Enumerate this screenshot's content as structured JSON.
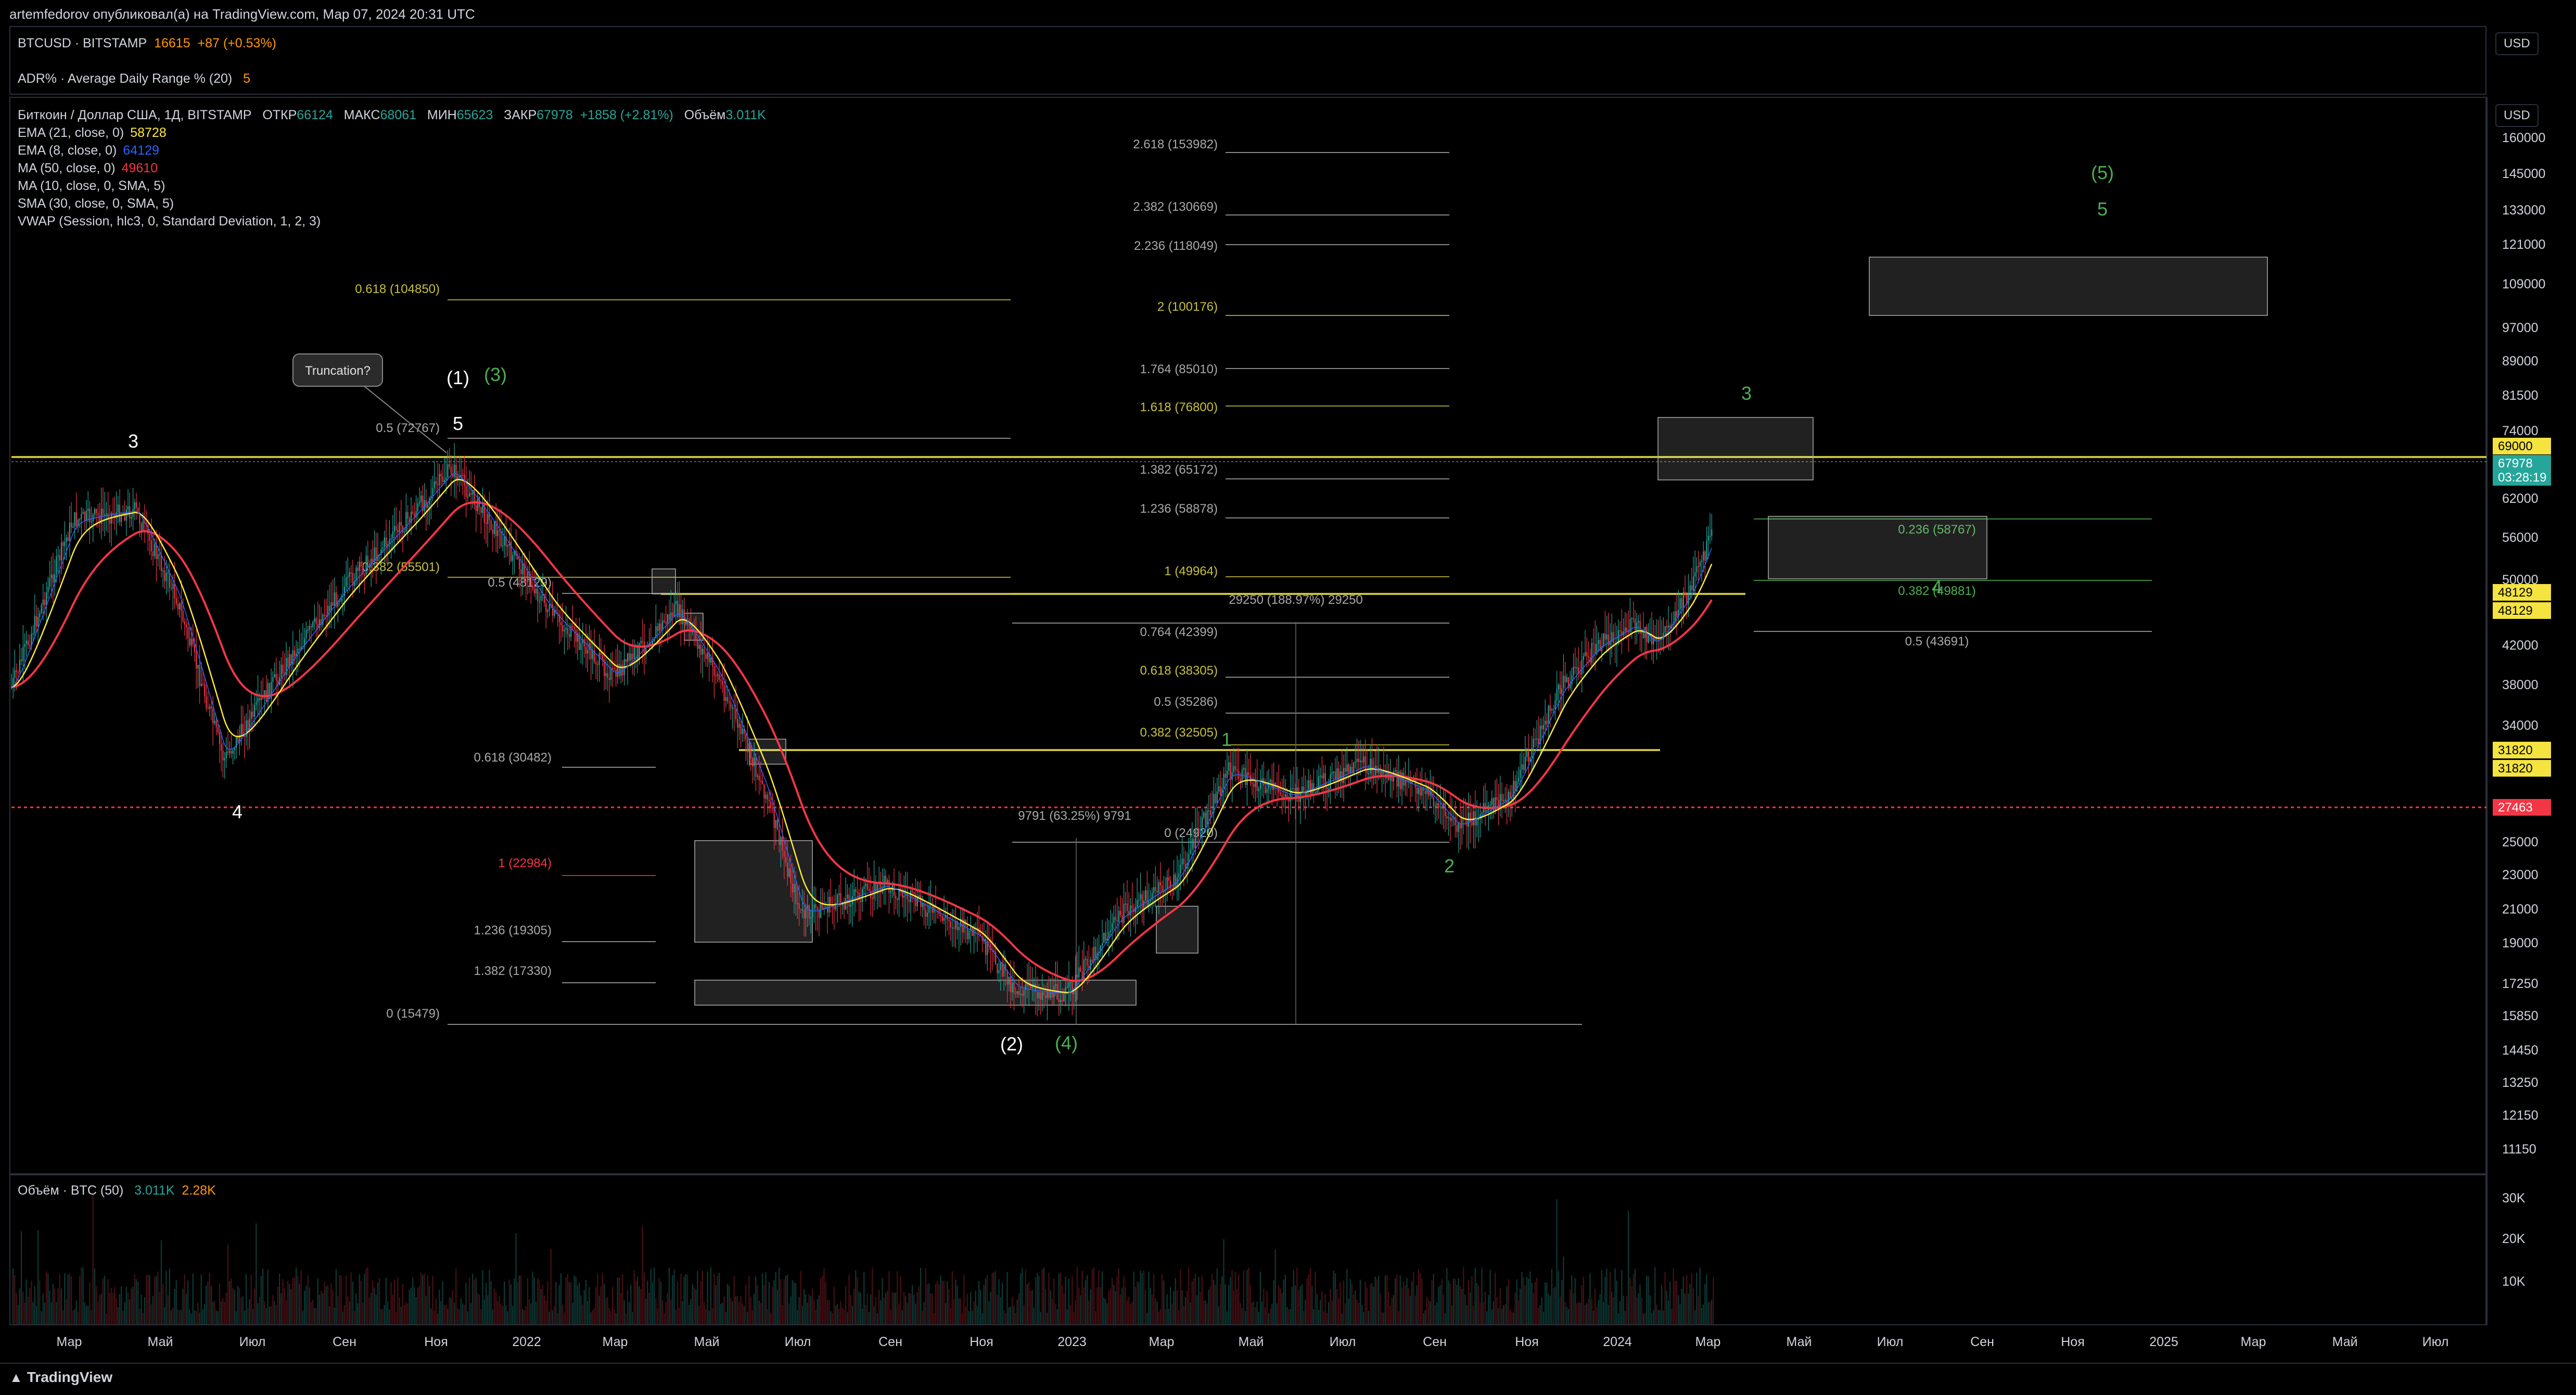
{
  "header": {
    "author_line": "artemfedorov опубликовал(а) на TradingView.com, Мар 07, 2024 20:31 UTC"
  },
  "top_panel": {
    "symbol": "BTCUSD · BITSTAMP",
    "value": "16615",
    "change": "+87 (+0.53%)",
    "indicator_name": "ADR% · Average Daily Range % (20)",
    "indicator_value": "5",
    "currency": "USD"
  },
  "main_legend": {
    "title": "Биткоин / Доллар США, 1Д, BITSTAMP",
    "open_label": "ОТКР",
    "open": "66124",
    "high_label": "МАКС",
    "high": "68061",
    "low_label": "МИН",
    "low": "65623",
    "close_label": "ЗАКР",
    "close": "67978",
    "change": "+1858 (+2.81%)",
    "volume_label": "Объём",
    "volume": "3.011K",
    "indicators": [
      {
        "name": "EMA (21, close, 0)",
        "value": "58728",
        "color": "#ffeb3b"
      },
      {
        "name": "EMA (8, close, 0)",
        "value": "64129",
        "color": "#2962ff"
      },
      {
        "name": "MA (50, close, 0)",
        "value": "49610",
        "color": "#f23645"
      },
      {
        "name": "MA (10, close, 0, SMA, 5)",
        "value": "",
        "color": "#d1d4dc"
      },
      {
        "name": "SMA (30, close, 0, SMA, 5)",
        "value": "",
        "color": "#d1d4dc"
      },
      {
        "name": "VWAP (Session, hlc3, 0, Standard Deviation, 1, 2, 3)",
        "value": "",
        "color": "#d1d4dc"
      }
    ],
    "currency": "USD"
  },
  "volume_panel": {
    "title": "Объём · BTC (50)",
    "value1": "3.011K",
    "value2": "2.28K",
    "value1_color": "#26a69a",
    "value2_color": "#ff9800",
    "scale": [
      "30K",
      "20K",
      "10K"
    ]
  },
  "price_axis": {
    "ticks": [
      "160000",
      "145000",
      "133000",
      "121000",
      "109000",
      "97000",
      "89000",
      "81500",
      "74000",
      "62000",
      "56000",
      "50000",
      "42000",
      "38000",
      "34000",
      "25000",
      "23000",
      "21000",
      "19000",
      "17250",
      "15850",
      "14450",
      "13250",
      "12150",
      "11150"
    ],
    "badges": [
      {
        "label": "69000",
        "bg": "#f5e33f",
        "fg": "#000000"
      },
      {
        "label": "67978",
        "bg": "#26a69a",
        "fg": "#ffffff"
      },
      {
        "label": "03:28:19",
        "bg": "#26a69a",
        "fg": "#ffffff"
      },
      {
        "label": "48129",
        "bg": "#f5e33f",
        "fg": "#000000"
      },
      {
        "label": "48129",
        "bg": "#f5e33f",
        "fg": "#000000"
      },
      {
        "label": "31820",
        "bg": "#f5e33f",
        "fg": "#000000"
      },
      {
        "label": "31820",
        "bg": "#f5e33f",
        "fg": "#000000"
      },
      {
        "label": "27463",
        "bg": "#f23645",
        "fg": "#ffffff"
      }
    ]
  },
  "time_axis": [
    "Мар",
    "Май",
    "Июл",
    "Сен",
    "Ноя",
    "2022",
    "Мар",
    "Май",
    "Июл",
    "Сен",
    "Ноя",
    "2023",
    "Мар",
    "Май",
    "Июл",
    "Сен",
    "Ноя",
    "2024",
    "Мар",
    "Май",
    "Июл",
    "Сен",
    "Ноя",
    "2025",
    "Мар",
    "Май",
    "Июл"
  ],
  "annotations": {
    "fib_levels": [
      "2.618 (153982)",
      "2.382 (130669)",
      "2.236 (118049)",
      "2 (100176)",
      "1.764 (85010)",
      "1.618 (76800)",
      "1.382 (65172)",
      "1.236 (58878)",
      "1 (49964)",
      "0.764 (42399)",
      "0.618 (38305)",
      "0.5 (35286)",
      "0.382 (32505)",
      "0 (24920)",
      "0.618 (104850)",
      "0.5 (72767)",
      "0.382 (55501)",
      "0.5 (48129)",
      "0.618 (30482)",
      "1 (22984)",
      "1.236 (19305)",
      "1.382 (17330)",
      "0 (15479)",
      "0.236 (58767)",
      "0.382 (49881)",
      "0.5 (43691)"
    ],
    "measure_1": "29250 (188.97%) 29250",
    "measure_2": "9791 (63.25%) 9791",
    "callout": "Truncation?",
    "waves_white": [
      "3",
      "4",
      "(1)",
      "5",
      "(2)"
    ],
    "waves_green": [
      "(3)",
      "(4)",
      "1",
      "2",
      "3",
      "4",
      "(5)",
      "5"
    ]
  },
  "footer": {
    "brand": "TradingView"
  },
  "colors": {
    "bg": "#000000",
    "up": "#26a69a",
    "down": "#f23645",
    "ema21": "#ffeb3b",
    "ma50": "#f23645",
    "level": "#c8c13a",
    "green_label": "#4caf50"
  }
}
